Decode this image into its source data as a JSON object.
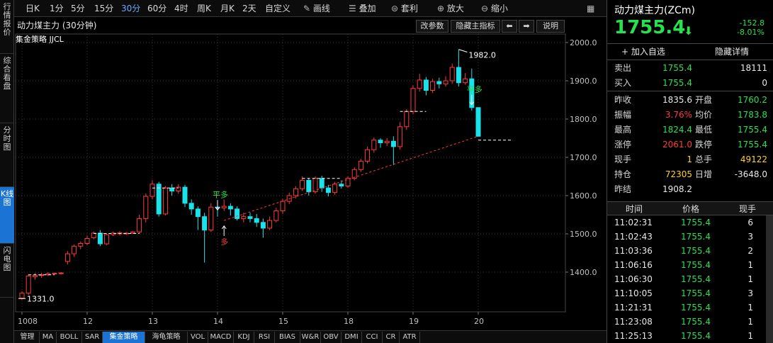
{
  "left_tabs": [
    "行情报价",
    "综合看盘",
    "分时图",
    "K线图",
    "闪电图"
  ],
  "toolbar": {
    "periods": [
      "日K",
      "1分",
      "5分",
      "15分",
      "30分",
      "60分",
      "4时",
      "周K",
      "月K",
      "2天",
      "自定义"
    ],
    "active_period": "30分",
    "tools": [
      {
        "icon": "pencil-icon",
        "label": "画线"
      },
      {
        "icon": "layers-icon",
        "label": "叠加"
      },
      {
        "icon": "arbitrage-icon",
        "label": "套利"
      },
      {
        "icon": "zoom-in-icon",
        "label": "放大"
      },
      {
        "icon": "zoom-out-icon",
        "label": "缩小"
      }
    ],
    "right_icon": "calendar-icon"
  },
  "chart_header": {
    "title": "动力煤主力 (30分钟)",
    "strategy": "集金策略 JJCL",
    "buttons": [
      "改参数",
      "隐藏主指标",
      "⬅",
      "➡",
      "说明"
    ]
  },
  "chart_data": {
    "type": "candlestick",
    "ylim": [
      1300,
      2000
    ],
    "yticks": [
      2000.0,
      1900.0,
      1800.0,
      1700.0,
      1600.0,
      1500.0,
      1400.0
    ],
    "xticks": [
      {
        "label": "1008",
        "index": 0
      },
      {
        "label": "12",
        "index": 10
      },
      {
        "label": "13",
        "index": 20
      },
      {
        "label": "14",
        "index": 30
      },
      {
        "label": "15",
        "index": 40
      },
      {
        "label": "18",
        "index": 50
      },
      {
        "label": "19",
        "index": 60
      },
      {
        "label": "20",
        "index": 70
      }
    ],
    "candles": [
      [
        1332,
        1345,
        1328,
        1350
      ],
      [
        1345,
        1390,
        1340,
        1395
      ],
      [
        1388,
        1392,
        1380,
        1398
      ],
      [
        1392,
        1393,
        1385,
        1398
      ],
      [
        1393,
        1396,
        1390,
        1400
      ],
      [
        1396,
        1397,
        1394,
        1399
      ],
      [
        1396,
        1398,
        1394,
        1400
      ],
      [
        1428,
        1448,
        1420,
        1455
      ],
      [
        1448,
        1468,
        1440,
        1472
      ],
      [
        1468,
        1475,
        1460,
        1480
      ],
      [
        1475,
        1488,
        1470,
        1495
      ],
      [
        1490,
        1502,
        1486,
        1506
      ],
      [
        1502,
        1474,
        1468,
        1510
      ],
      [
        1474,
        1498,
        1470,
        1502
      ],
      [
        1498,
        1502,
        1494,
        1506
      ],
      [
        1500,
        1503,
        1496,
        1507
      ],
      [
        1500,
        1502,
        1497,
        1505
      ],
      [
        1502,
        1505,
        1500,
        1507
      ],
      [
        1505,
        1540,
        1500,
        1550
      ],
      [
        1540,
        1598,
        1530,
        1606
      ],
      [
        1598,
        1630,
        1590,
        1640
      ],
      [
        1630,
        1552,
        1545,
        1636
      ],
      [
        1552,
        1620,
        1548,
        1625
      ],
      [
        1620,
        1612,
        1600,
        1630
      ],
      [
        1612,
        1622,
        1605,
        1630
      ],
      [
        1622,
        1580,
        1570,
        1628
      ],
      [
        1580,
        1565,
        1550,
        1590
      ],
      [
        1565,
        1545,
        1510,
        1572
      ],
      [
        1545,
        1510,
        1425,
        1555
      ],
      [
        1510,
        1570,
        1505,
        1580
      ],
      [
        1570,
        1568,
        1545,
        1580
      ],
      [
        1568,
        1572,
        1560,
        1590
      ],
      [
        1572,
        1565,
        1548,
        1580
      ],
      [
        1565,
        1540,
        1535,
        1572
      ],
      [
        1540,
        1545,
        1530,
        1555
      ],
      [
        1545,
        1540,
        1530,
        1555
      ],
      [
        1540,
        1530,
        1518,
        1552
      ],
      [
        1530,
        1515,
        1490,
        1540
      ],
      [
        1515,
        1535,
        1510,
        1545
      ],
      [
        1535,
        1560,
        1530,
        1568
      ],
      [
        1560,
        1585,
        1552,
        1592
      ],
      [
        1585,
        1600,
        1578,
        1608
      ],
      [
        1600,
        1618,
        1592,
        1624
      ],
      [
        1618,
        1640,
        1612,
        1650
      ],
      [
        1640,
        1610,
        1600,
        1645
      ],
      [
        1610,
        1645,
        1605,
        1650
      ],
      [
        1645,
        1620,
        1610,
        1652
      ],
      [
        1620,
        1608,
        1598,
        1628
      ],
      [
        1608,
        1630,
        1602,
        1636
      ],
      [
        1630,
        1625,
        1618,
        1640
      ],
      [
        1625,
        1645,
        1620,
        1650
      ],
      [
        1645,
        1668,
        1640,
        1674
      ],
      [
        1668,
        1690,
        1662,
        1696
      ],
      [
        1690,
        1720,
        1684,
        1728
      ],
      [
        1720,
        1745,
        1712,
        1752
      ],
      [
        1745,
        1738,
        1725,
        1750
      ],
      [
        1738,
        1742,
        1730,
        1750
      ],
      [
        1742,
        1728,
        1680,
        1755
      ],
      [
        1728,
        1780,
        1720,
        1792
      ],
      [
        1780,
        1820,
        1772,
        1826
      ],
      [
        1820,
        1880,
        1812,
        1888
      ],
      [
        1880,
        1902,
        1872,
        1918
      ],
      [
        1902,
        1875,
        1862,
        1910
      ],
      [
        1875,
        1898,
        1868,
        1905
      ],
      [
        1898,
        1892,
        1880,
        1908
      ],
      [
        1892,
        1900,
        1885,
        1912
      ],
      [
        1900,
        1935,
        1892,
        1945
      ],
      [
        1935,
        1895,
        1885,
        1982
      ],
      [
        1895,
        1905,
        1890,
        1920
      ],
      [
        1905,
        1830,
        1822,
        1932
      ],
      [
        1830,
        1755,
        1755,
        1824
      ]
    ],
    "candle_index_layout_note": "",
    "stops": [
      {
        "start": 1,
        "end": 5,
        "value": 1393
      },
      {
        "start": 11,
        "end": 18,
        "value": 1501
      },
      {
        "start": 20,
        "end": 24,
        "value": 1620
      },
      {
        "start": 43,
        "end": 49,
        "value": 1645
      },
      {
        "start": 58,
        "end": 62,
        "value": 1820
      },
      {
        "start": 70,
        "end": 75,
        "value": 1745
      }
    ],
    "trend_line": {
      "from": {
        "index": 31,
        "value": 1535
      },
      "to": {
        "index": 70,
        "value": 1755
      }
    },
    "annotations": {
      "low_label": "1331.0",
      "high_label": "1982.0",
      "signals": [
        {
          "index": 30,
          "text": "平多",
          "color": "#27e14f",
          "value": 1555,
          "position": "above"
        },
        {
          "index": 31,
          "text": "多",
          "color": "#ff3b3b",
          "value": 1528,
          "position": "below"
        },
        {
          "index": 69,
          "text": "平多",
          "color": "#27e14f",
          "value": 1830,
          "position": "above"
        }
      ]
    }
  },
  "indicators": [
    "管理",
    "MA",
    "BOLL",
    "SAR",
    "集金策略",
    "海龟策略",
    "VOL",
    "MACD",
    "KDJ",
    "RSI",
    "BIAS",
    "W&R",
    "OBV",
    "DMI",
    "CCI",
    "CR",
    "ATR"
  ],
  "active_indicator": "集金策略",
  "quote": {
    "title": "动力煤主力(ZCm)",
    "price": "1755.4",
    "change": "-152.8",
    "change_pct": "-8.01%",
    "add_watch": "加入自选",
    "hide_detail": "隐藏详情",
    "sell": {
      "label": "卖出",
      "price": "1755.4",
      "vol": "18111"
    },
    "buy": {
      "label": "买入",
      "price": "1755.4",
      "vol": "0"
    },
    "stats": [
      {
        "l1": "昨收",
        "v1": "1835.6",
        "c1": "w",
        "l2": "开盘",
        "v2": "1760.2",
        "c2": "g"
      },
      {
        "l1": "振幅",
        "v1": "3.76%",
        "c1": "r",
        "l2": "均价",
        "v2": "1783.8",
        "c2": "g"
      },
      {
        "l1": "最高",
        "v1": "1824.4",
        "c1": "g",
        "l2": "最低",
        "v2": "1755.4",
        "c2": "g"
      },
      {
        "l1": "涨停",
        "v1": "2061.0",
        "c1": "r",
        "l2": "跌停",
        "v2": "1755.4",
        "c2": "g"
      },
      {
        "l1": "现手",
        "v1": "1",
        "c1": "y",
        "l2": "总手",
        "v2": "49122",
        "c2": "y"
      },
      {
        "l1": "持仓",
        "v1": "72305",
        "c1": "y",
        "l2": "日增",
        "v2": "-3648.0",
        "c2": "w"
      },
      {
        "l1": "昨结",
        "v1": "1908.2",
        "c1": "w",
        "l2": "",
        "v2": "",
        "c2": "w"
      }
    ],
    "ticks_header": [
      "时间",
      "价格",
      "现手"
    ],
    "ticks": [
      [
        "11:02:31",
        "1755.4",
        "6"
      ],
      [
        "11:02:43",
        "1755.4",
        "3"
      ],
      [
        "11:03:36",
        "1755.4",
        "2"
      ],
      [
        "11:06:16",
        "1755.4",
        "1"
      ],
      [
        "11:06:30",
        "1755.4",
        "1"
      ],
      [
        "11:10:05",
        "1755.4",
        "3"
      ],
      [
        "11:21:31",
        "1755.4",
        "1"
      ],
      [
        "11:23:08",
        "1755.4",
        "1"
      ],
      [
        "11:25:13",
        "1755.4",
        "1"
      ]
    ]
  },
  "colors": {
    "up": "#ff3b3b",
    "down": "#19e3ea",
    "grid": "#3a3a3a",
    "green": "#27e14f"
  }
}
